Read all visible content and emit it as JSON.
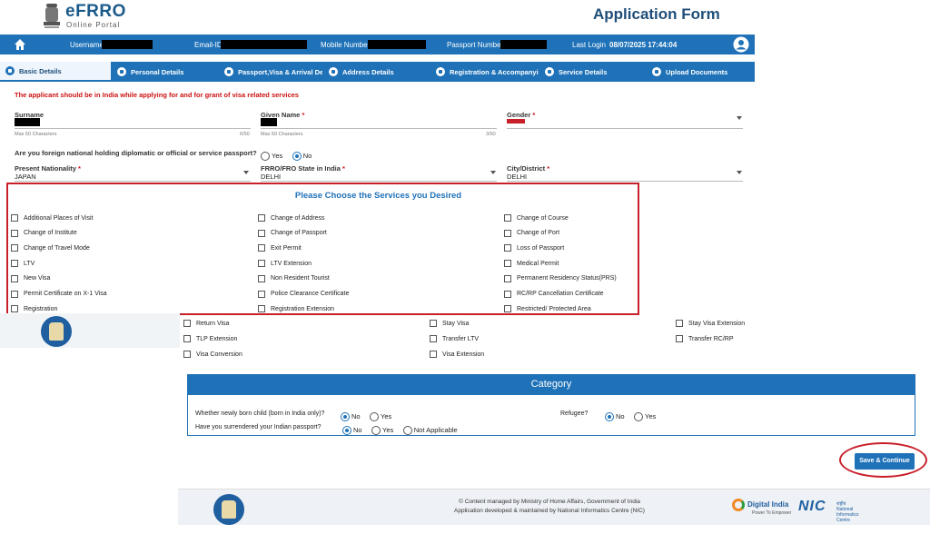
{
  "header": {
    "logo_title": "eFRRO",
    "logo_subtitle": "Online Portal",
    "page_heading": "Application Form"
  },
  "infobar": {
    "username_label": "Username",
    "email_label": "Email-ID",
    "mobile_label": "Mobile Number",
    "passport_label": "Passport Number",
    "last_login_label": "Last Login",
    "last_login_value": "08/07/2025 17:44:04"
  },
  "tabs": [
    {
      "label": "Basic Details"
    },
    {
      "label": "Personal Details"
    },
    {
      "label": "Passport,Visa & Arrival Details"
    },
    {
      "label": "Address Details"
    },
    {
      "label": "Registration & Accompanying"
    },
    {
      "label": "Service Details"
    },
    {
      "label": "Upload Documents"
    }
  ],
  "notice": "The applicant should be in India while applying for and for grant of visa related services",
  "form": {
    "surname_label": "Surname",
    "surname_hint": "Max 50 Characters",
    "surname_count": "6/50",
    "given_name_label": "Given Name",
    "given_name_hint": "Max 50 Characters",
    "given_name_count": "3/50",
    "gender_label": "Gender",
    "diplomatic_question": "Are you foreign national holding diplomatic or official or service passport?",
    "yes": "Yes",
    "no": "No",
    "nationality_label": "Present Nationality",
    "nationality_value": "JAPAN",
    "frro_label": "FRRO/FRO State in India",
    "frro_value": "DELHI",
    "city_label": "City/District",
    "city_value": "DELHI"
  },
  "services": {
    "title": "Please Choose the Services you Desired",
    "col1": [
      "Additional Places of Visit",
      "Change of Institute",
      "Change of Travel Mode",
      "LTV",
      "New Visa",
      "Permit Certificate on X-1 Visa",
      "Registration"
    ],
    "col2": [
      "Change of Address",
      "Change of Passport",
      "Exit Permit",
      "LTV Extension",
      "Non Resident Tourist",
      "Police Clearance Certificate",
      "Registration Extension"
    ],
    "col3": [
      "Change of Course",
      "Change of Port",
      "Loss of Passport",
      "Medical Permit",
      "Permanent Residency Status(PRS)",
      "RC/RP Cancellation Certificate",
      "Restricted/ Protected Area"
    ],
    "extra_col1": [
      "Return Visa",
      "TLP Extension",
      "Visa Conversion"
    ],
    "extra_col2": [
      "Stay Visa",
      "Transfer LTV",
      "Visa Extension"
    ],
    "extra_col3": [
      "Stay Visa Extension",
      "Transfer RC/RP"
    ]
  },
  "category": {
    "title": "Category",
    "q1": "Whether newly born child (born in India only)?",
    "q2": "Have you surrendered your Indian passport?",
    "q3": "Refugee?",
    "no": "No",
    "yes": "Yes",
    "not_applicable": "Not Applicable"
  },
  "actions": {
    "save_continue": "Save & Continue"
  },
  "footer": {
    "line1": "© Content managed by Ministry of Home Affairs, Government of India",
    "line2": "Application developed & maintained by National Informatics Centre (NIC)",
    "digital_india": "Digital India",
    "digital_india_sub": "Power To Empower",
    "nic": "NIC",
    "nic_sub1": "राष्ट्रीय",
    "nic_sub2": "National",
    "nic_sub3": "Informatics",
    "nic_sub4": "Centre"
  },
  "colors": {
    "primary": "#1f72b8",
    "heading": "#1f4e79",
    "alert": "#cc1111",
    "highlight": "#c8202b"
  }
}
